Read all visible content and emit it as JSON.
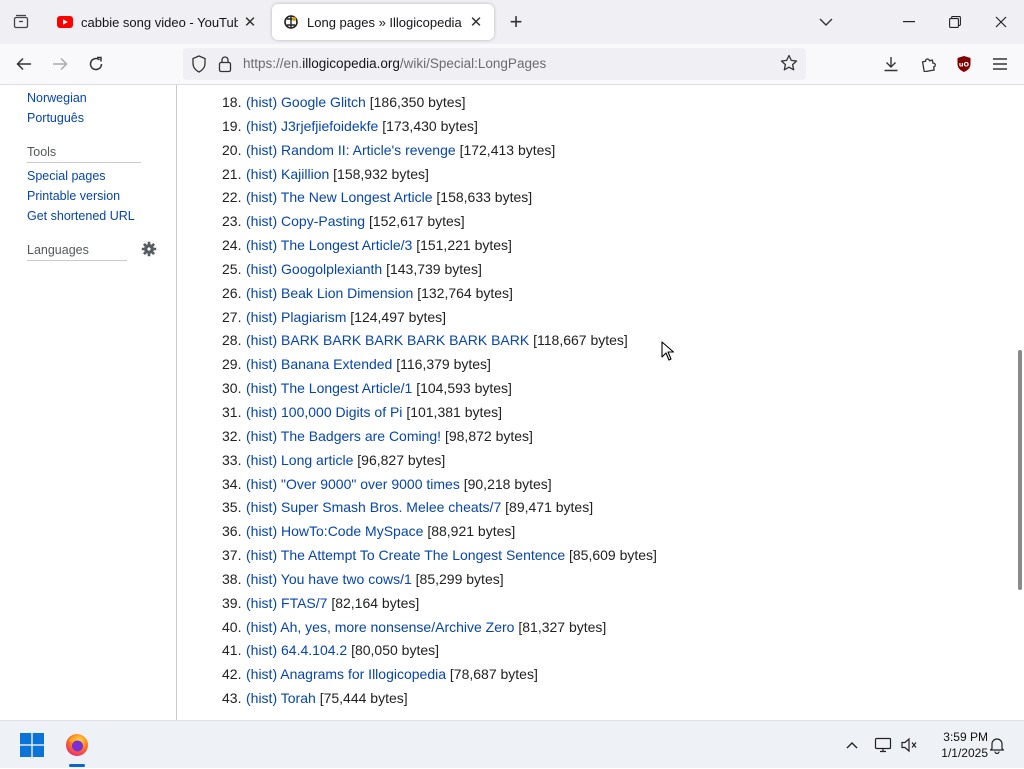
{
  "browser": {
    "tabs": [
      {
        "title": "cabbie song video - YouTube",
        "active": false,
        "favicon": "youtube-icon"
      },
      {
        "title": "Long pages » Illogicopedia - Th",
        "active": true,
        "favicon": "illogicopedia-icon"
      }
    ],
    "url_prefix": "https://en.",
    "url_host": "illogicopedia.org",
    "url_path": "/wiki/Special:LongPages"
  },
  "sidebar": {
    "languages_top": [
      "Norwegian",
      "Português"
    ],
    "tools_heading": "Tools",
    "tools": [
      "Special pages",
      "Printable version",
      "Get shortened URL"
    ],
    "languages_heading": "Languages"
  },
  "entries": [
    {
      "num": "18.",
      "hist": "(hist)",
      "title": "Google Glitch",
      "size": "[186,350 bytes]"
    },
    {
      "num": "19.",
      "hist": "(hist)",
      "title": "J3rjefjiefoidekfe",
      "size": "[173,430 bytes]"
    },
    {
      "num": "20.",
      "hist": "(hist)",
      "title": "Random II: Article's revenge",
      "size": "[172,413 bytes]"
    },
    {
      "num": "21.",
      "hist": "(hist)",
      "title": "Kajillion",
      "size": "[158,932 bytes]"
    },
    {
      "num": "22.",
      "hist": "(hist)",
      "title": "The New Longest Article",
      "size": "[158,633 bytes]"
    },
    {
      "num": "23.",
      "hist": "(hist)",
      "title": "Copy-Pasting",
      "size": "[152,617 bytes]"
    },
    {
      "num": "24.",
      "hist": "(hist)",
      "title": "The Longest Article/3",
      "size": "[151,221 bytes]"
    },
    {
      "num": "25.",
      "hist": "(hist)",
      "title": "Googolplexianth",
      "size": "[143,739 bytes]"
    },
    {
      "num": "26.",
      "hist": "(hist)",
      "title": "Beak Lion Dimension",
      "size": "[132,764 bytes]"
    },
    {
      "num": "27.",
      "hist": "(hist)",
      "title": "Plagiarism",
      "size": "[124,497 bytes]"
    },
    {
      "num": "28.",
      "hist": "(hist)",
      "title": "BARK BARK BARK BARK BARK BARK",
      "size": "[118,667 bytes]"
    },
    {
      "num": "29.",
      "hist": "(hist)",
      "title": "Banana Extended",
      "size": "[116,379 bytes]"
    },
    {
      "num": "30.",
      "hist": "(hist)",
      "title": "The Longest Article/1",
      "size": "[104,593 bytes]"
    },
    {
      "num": "31.",
      "hist": "(hist)",
      "title": "100,000 Digits of Pi",
      "size": "[101,381 bytes]"
    },
    {
      "num": "32.",
      "hist": "(hist)",
      "title": "The Badgers are Coming!",
      "size": "[98,872 bytes]"
    },
    {
      "num": "33.",
      "hist": "(hist)",
      "title": "Long article",
      "size": "[96,827 bytes]"
    },
    {
      "num": "34.",
      "hist": "(hist)",
      "title": "\"Over 9000\" over 9000 times",
      "size": "[90,218 bytes]"
    },
    {
      "num": "35.",
      "hist": "(hist)",
      "title": "Super Smash Bros. Melee cheats/7",
      "size": "[89,471 bytes]"
    },
    {
      "num": "36.",
      "hist": "(hist)",
      "title": "HowTo:Code MySpace",
      "size": "[88,921 bytes]"
    },
    {
      "num": "37.",
      "hist": "(hist)",
      "title": "The Attempt To Create The Longest Sentence",
      "size": "[85,609 bytes]"
    },
    {
      "num": "38.",
      "hist": "(hist)",
      "title": "You have two cows/1",
      "size": "[85,299 bytes]"
    },
    {
      "num": "39.",
      "hist": "(hist)",
      "title": "FTAS/7",
      "size": "[82,164 bytes]"
    },
    {
      "num": "40.",
      "hist": "(hist)",
      "title": "Ah, yes, more nonsense/Archive Zero",
      "size": "[81,327 bytes]"
    },
    {
      "num": "41.",
      "hist": "(hist)",
      "title": "64.4.104.2",
      "size": "[80,050 bytes]"
    },
    {
      "num": "42.",
      "hist": "(hist)",
      "title": "Anagrams for Illogicopedia",
      "size": "[78,687 bytes]"
    },
    {
      "num": "43.",
      "hist": "(hist)",
      "title": "Torah",
      "size": "[75,444 bytes]"
    }
  ],
  "taskbar": {
    "time": "3:59 PM",
    "date": "1/1/2025"
  },
  "colors": {
    "link": "#0645ad",
    "text": "#202122",
    "tabstrip": "#f0f0f4"
  }
}
